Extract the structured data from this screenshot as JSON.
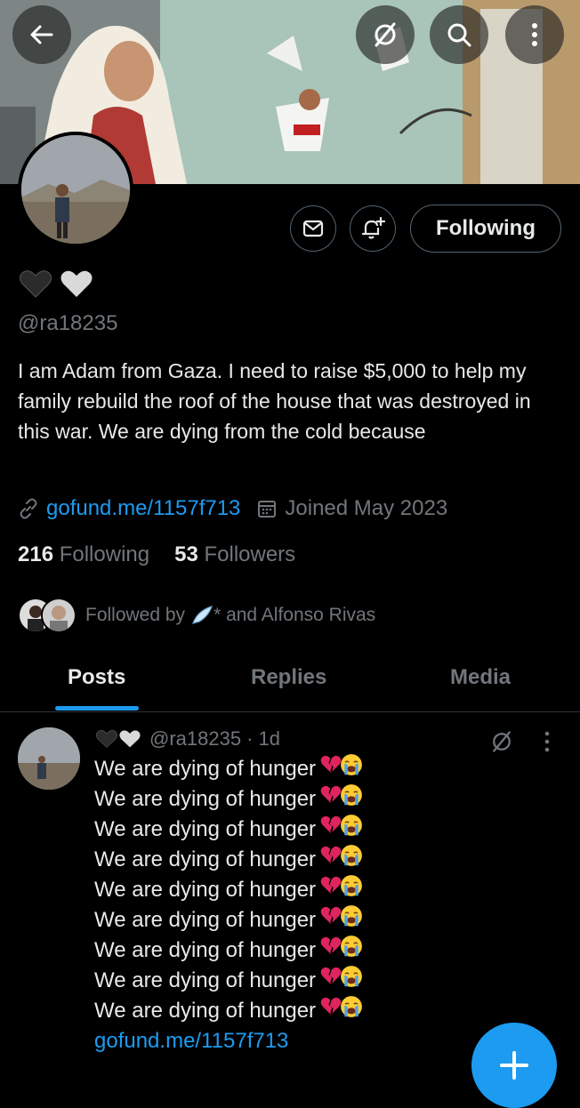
{
  "profile": {
    "handle": "@ra18235",
    "bio": "I am Adam from Gaza. I need to raise $5,000 to help my family rebuild the roof of the house that was destroyed in this war. We are dying from the cold because",
    "link": "gofund.me/1157f713",
    "joined": "Joined May 2023",
    "following_count": "216",
    "following_label": "Following",
    "followers_count": "53",
    "followers_label": "Followers",
    "followed_by_prefix": "Followed by",
    "followed_by_suffix": "* and Alfonso Rivas",
    "follow_button": "Following"
  },
  "tabs": [
    {
      "label": "Posts",
      "active": true
    },
    {
      "label": "Replies",
      "active": false
    },
    {
      "label": "Media",
      "active": false
    }
  ],
  "post": {
    "handle": "@ra18235",
    "time": "· 1d",
    "lines": [
      "We are dying of hunger",
      "We are dying of hunger",
      "We are dying of hunger",
      "We are dying of hunger",
      "We are dying of hunger",
      "We are dying of hunger",
      "We are dying of hunger",
      "We are dying of hunger",
      "We are dying of hunger"
    ],
    "link": "gofund.me/1157f713"
  },
  "icons": {
    "back": "arrow-left-icon",
    "hide": "slashed-circle-icon",
    "search": "search-icon",
    "more": "more-vertical-icon",
    "message": "envelope-icon",
    "notify": "bell-plus-icon",
    "link": "link-icon",
    "calendar": "calendar-icon",
    "compose": "plus-icon"
  },
  "colors": {
    "accent": "#1d9bf0",
    "muted": "#71767b",
    "text": "#e7e9ea",
    "background": "#000000"
  }
}
